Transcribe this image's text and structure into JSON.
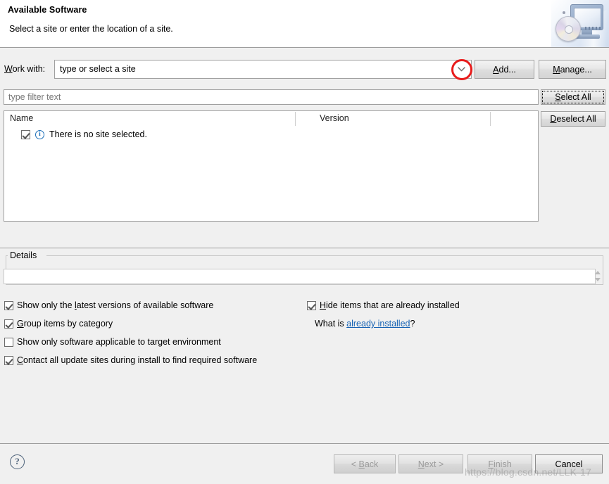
{
  "header": {
    "title": "Available Software",
    "subtitle": "Select a site or enter the location of a site.",
    "icon": "computer-with-cd-icon"
  },
  "work_with": {
    "label_before": "W",
    "label_after": "ork with:",
    "combo_value": "type or select a site",
    "dropdown_icon": "chevron-down-icon",
    "annotation": "red-circle-highlight",
    "annotation_color": "#e81b1b",
    "add_button": {
      "mnemonic": "A",
      "rest": "dd..."
    },
    "manage_button": {
      "mnemonic": "M",
      "rest": "anage..."
    }
  },
  "filter": {
    "placeholder": "type filter text",
    "select_all": {
      "mnemonic": "S",
      "rest": "elect All"
    },
    "deselect_all": {
      "mnemonic": "D",
      "rest": "eselect All"
    }
  },
  "table": {
    "columns": [
      "Name",
      "Version"
    ],
    "rows": [
      {
        "checked": true,
        "icon": "info-icon",
        "icon_glyph": "i",
        "name": "There is no site selected.",
        "version": ""
      }
    ]
  },
  "details": {
    "label": "Details",
    "value": "",
    "spinner_up_icon": "triangle-up-icon",
    "spinner_down_icon": "triangle-down-icon"
  },
  "options": {
    "left": [
      {
        "checked": true,
        "pre": "Show only the ",
        "mnemonic": "l",
        "post": "atest versions of available software"
      },
      {
        "checked": true,
        "pre": "",
        "mnemonic": "G",
        "post": "roup items by category"
      },
      {
        "checked": false,
        "pre": "",
        "mnemonic": "S",
        "post": "how only software applicable to target environment"
      },
      {
        "checked": true,
        "pre": "",
        "mnemonic": "C",
        "post": "ontact all update sites during install to find required software"
      }
    ],
    "right": [
      {
        "checked": true,
        "pre": "",
        "mnemonic": "H",
        "post": "ide items that are already installed"
      }
    ],
    "whatis_prefix": "What is ",
    "whatis_link": "already installed",
    "whatis_suffix": "?"
  },
  "footer": {
    "help_icon": "help-question-icon",
    "help_glyph": "?",
    "buttons": [
      {
        "name": "back",
        "pre": "< ",
        "mnemonic": "B",
        "post": "ack",
        "enabled": false
      },
      {
        "name": "next",
        "pre": "",
        "mnemonic": "N",
        "post": "ext >",
        "enabled": false
      },
      {
        "name": "finish",
        "pre": "",
        "mnemonic": "F",
        "post": "inish",
        "enabled": false
      },
      {
        "name": "cancel",
        "pre": "",
        "mnemonic": "C",
        "post": "ancel",
        "enabled": true
      }
    ]
  },
  "watermark": "https://blog.csdn.net/LLK-17"
}
